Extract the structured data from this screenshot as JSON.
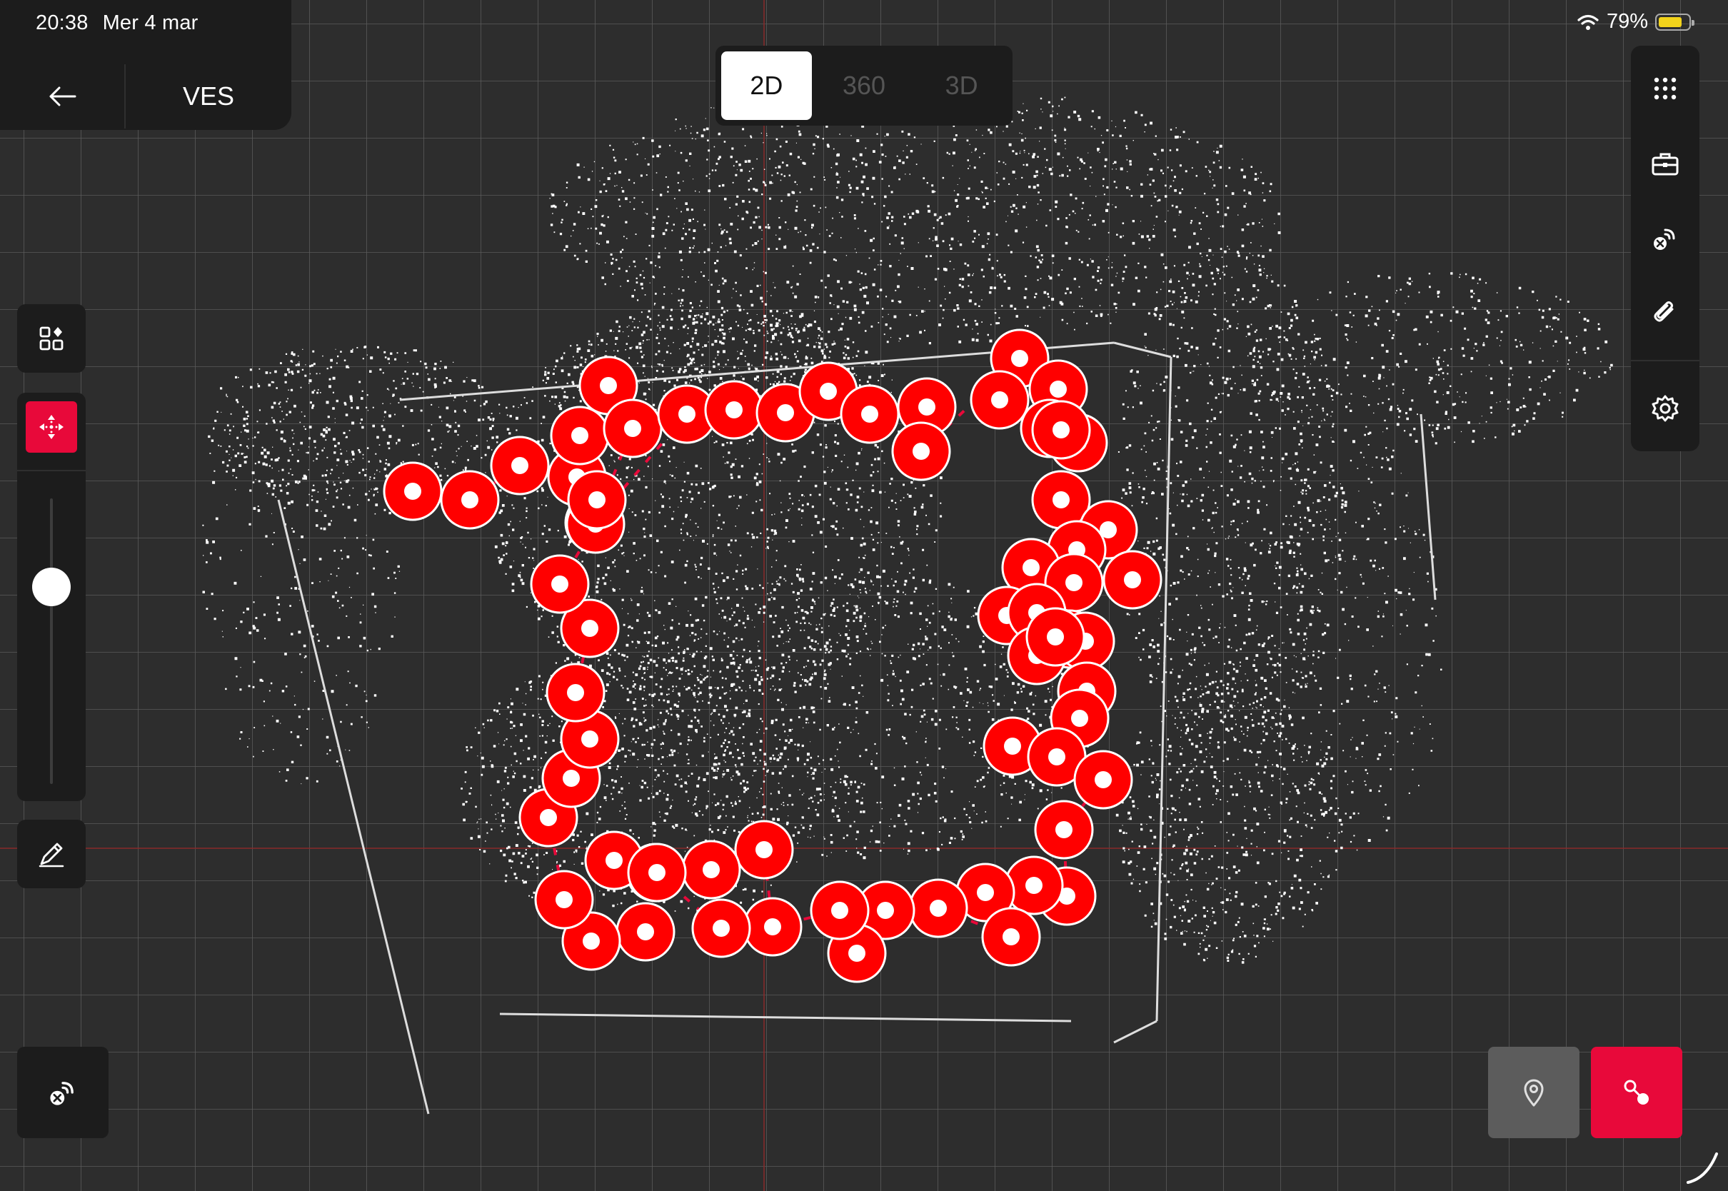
{
  "status": {
    "time": "20:38",
    "date": "Mer 4 mar",
    "battery": "79%",
    "battery_fraction": 0.79,
    "battery_color": "#f2d31b"
  },
  "header": {
    "title": "VES",
    "back_icon": "arrow-left-icon"
  },
  "view_modes": {
    "tabs": [
      {
        "label": "2D",
        "active": true
      },
      {
        "label": "360",
        "active": false
      },
      {
        "label": "3D",
        "active": false
      }
    ]
  },
  "right_toolbar": {
    "items": [
      "grid-dots-icon",
      "toolbox-icon",
      "signal-disconnect-icon",
      "paperclip-icon",
      "gear-icon"
    ]
  },
  "left_toolbar": {
    "items": [
      "widgets-icon",
      "move-arrows-icon",
      "height-slider",
      "pen-icon"
    ],
    "slider_level": 0.69
  },
  "bottom_controls": {
    "left": "signal-disconnect-icon",
    "right": [
      "map-pin-icon",
      "route-points-icon"
    ]
  },
  "colors": {
    "background": "#2d2d2d",
    "panel": "#1c1c1c",
    "accent": "#e8093a",
    "scan_marker": "#ff0000",
    "point_cloud": "#ffffff",
    "grid": "#5a5a5a"
  }
}
